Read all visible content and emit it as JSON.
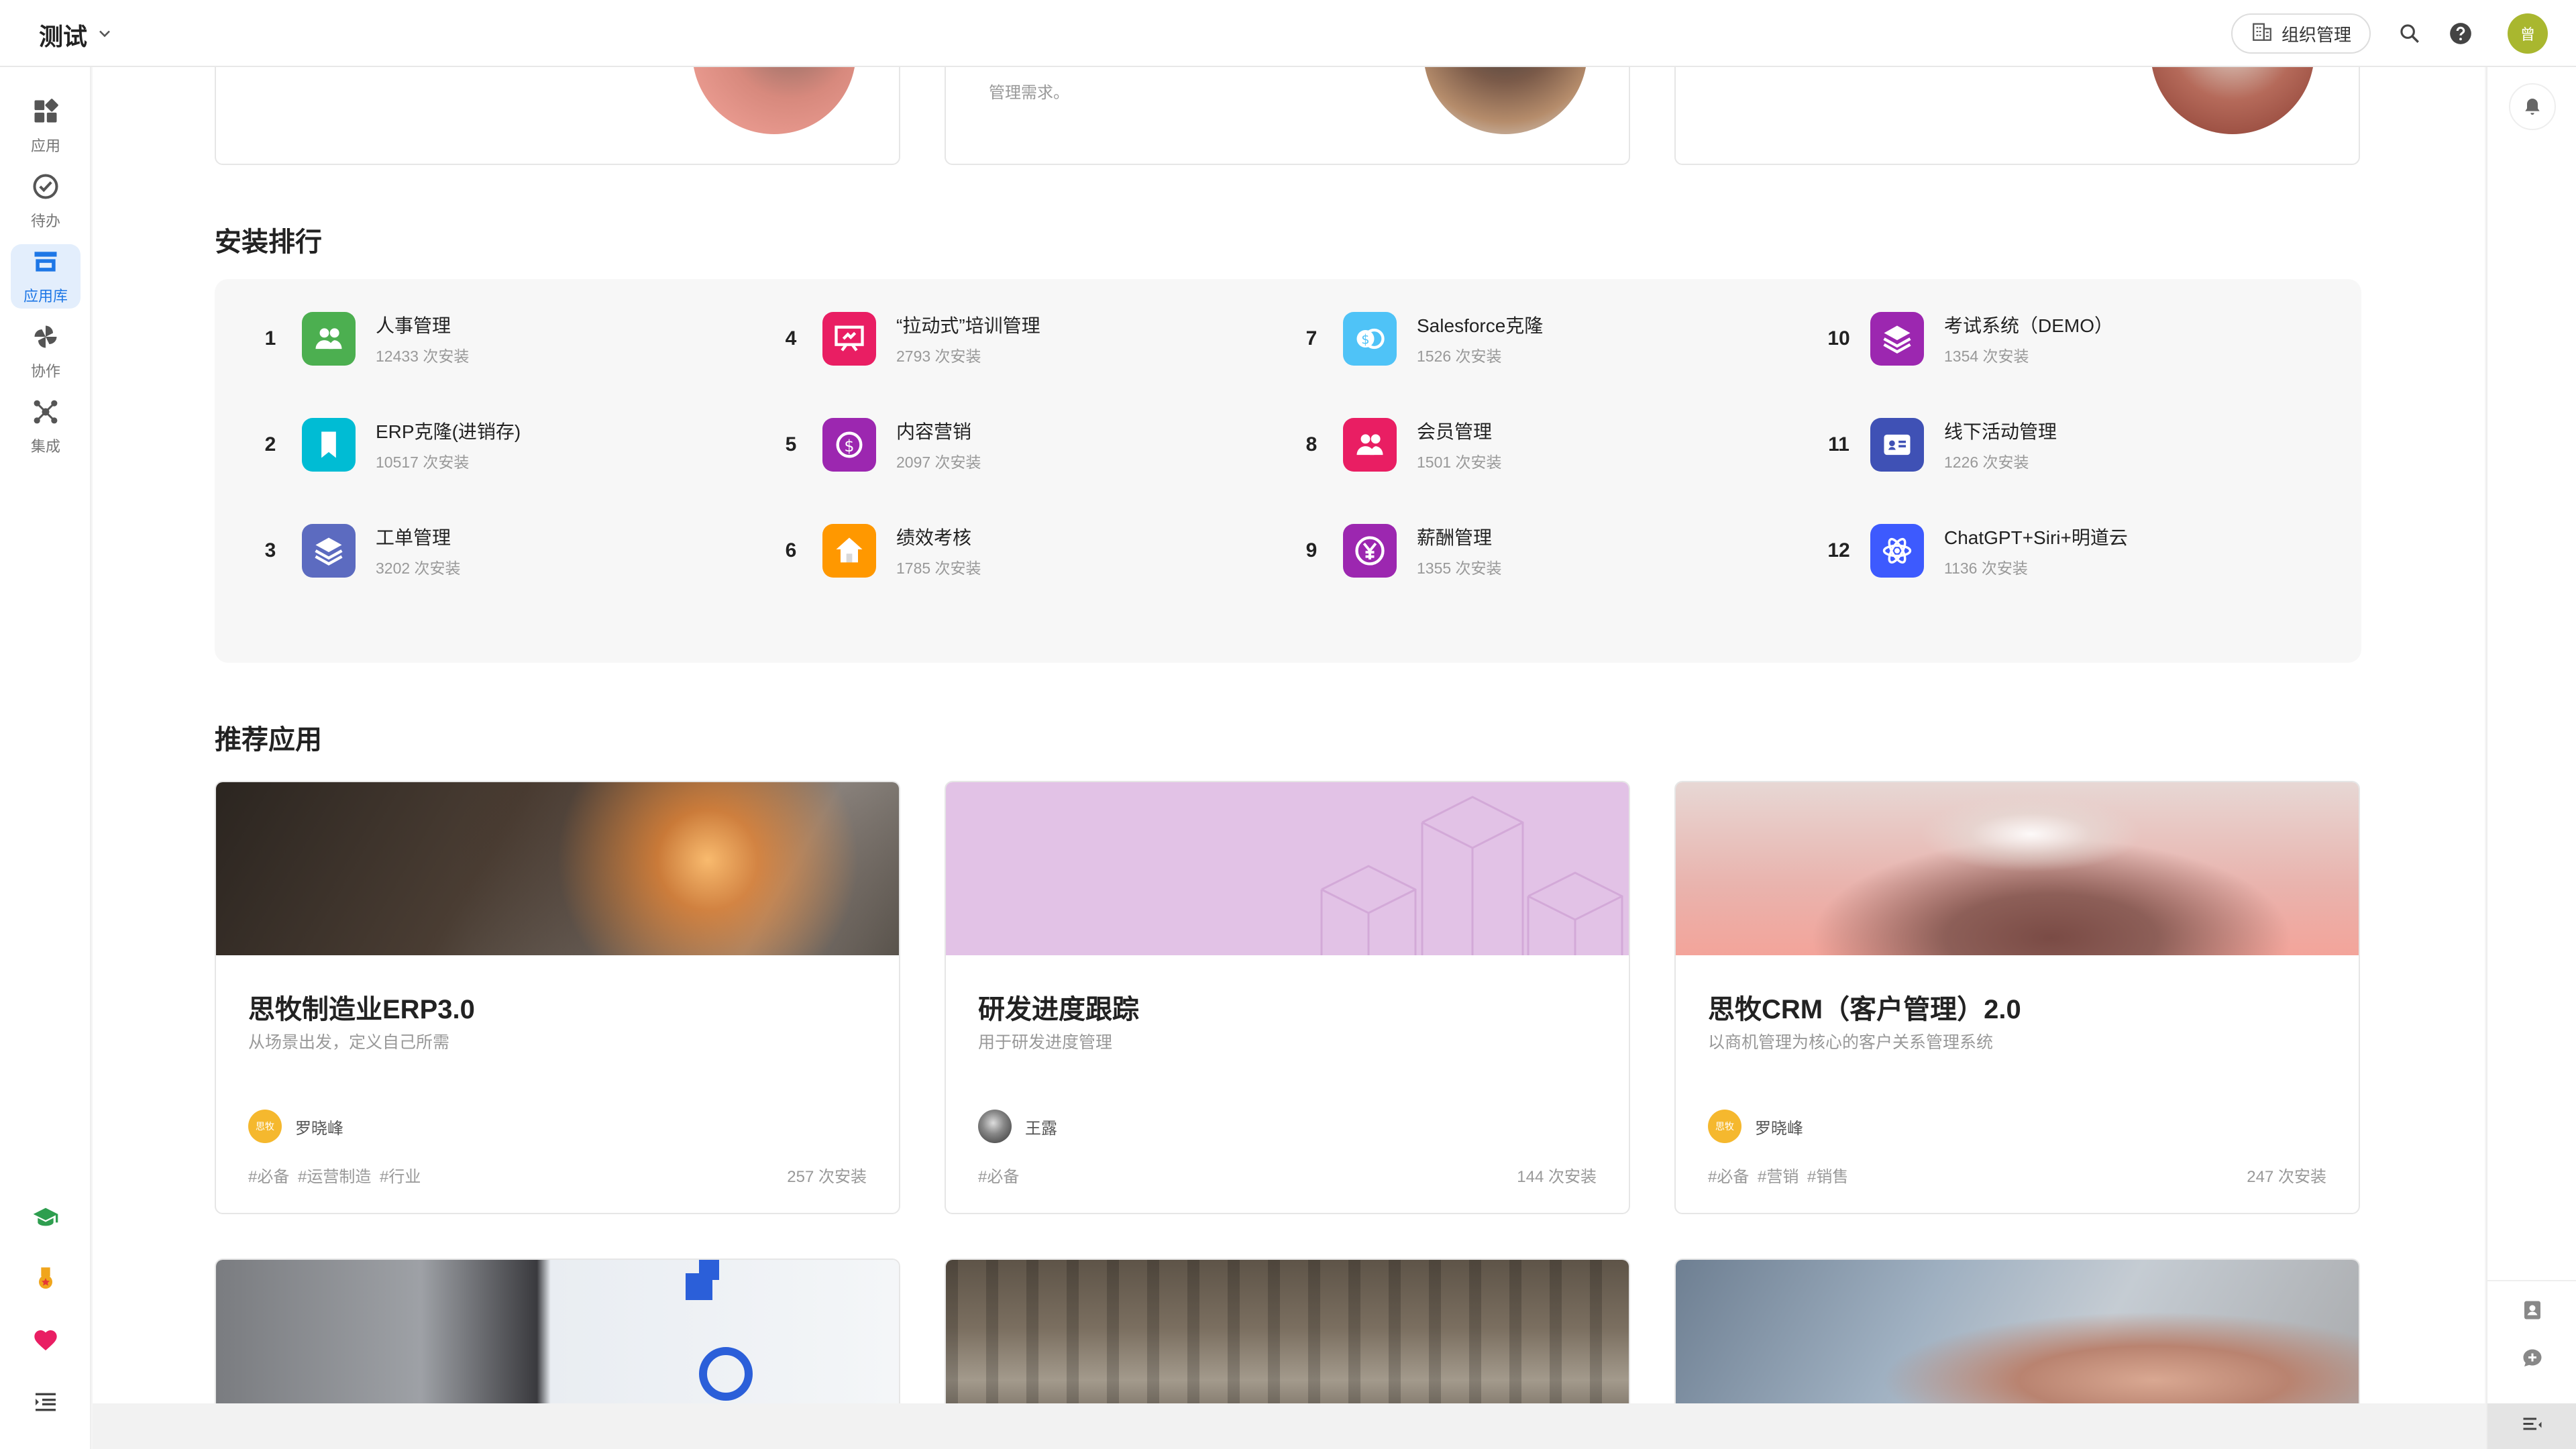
{
  "workspace": {
    "title": "测试"
  },
  "topbar": {
    "org_button": "组织管理",
    "avatar_text": "曾"
  },
  "nav": {
    "items": [
      {
        "label": "应用",
        "icon": "apps-icon"
      },
      {
        "label": "待办",
        "icon": "check-circle-icon"
      },
      {
        "label": "应用库",
        "icon": "store-icon"
      },
      {
        "label": "协作",
        "icon": "pinwheel-icon"
      },
      {
        "label": "集成",
        "icon": "integration-icon"
      }
    ]
  },
  "top_cards": [
    {
      "desc": ""
    },
    {
      "desc": "管理需求。"
    },
    {
      "desc": ""
    }
  ],
  "ranking": {
    "title": "安装排行",
    "items": [
      {
        "rank": "1",
        "name": "人事管理",
        "count": "12433 次安装",
        "color": "#4caf50",
        "icon": "people-icon"
      },
      {
        "rank": "2",
        "name": "ERP克隆(进销存)",
        "count": "10517 次安装",
        "color": "#00bcd4",
        "icon": "bookmark-icon"
      },
      {
        "rank": "3",
        "name": "工单管理",
        "count": "3202 次安装",
        "color": "#5c6bc0",
        "icon": "layers-icon"
      },
      {
        "rank": "4",
        "name": "“拉动式”培训管理",
        "count": "2793 次安装",
        "color": "#e91e63",
        "icon": "presentation-icon"
      },
      {
        "rank": "5",
        "name": "内容营销",
        "count": "2097 次安装",
        "color": "#9c27b0",
        "icon": "money-icon"
      },
      {
        "rank": "6",
        "name": "绩效考核",
        "count": "1785 次安装",
        "color": "#ff9800",
        "icon": "home-icon"
      },
      {
        "rank": "7",
        "name": "Salesforce克隆",
        "count": "1526 次安装",
        "color": "#4fc3f7",
        "icon": "coins-icon"
      },
      {
        "rank": "8",
        "name": "会员管理",
        "count": "1501 次安装",
        "color": "#e91e63",
        "icon": "people-icon"
      },
      {
        "rank": "9",
        "name": "薪酬管理",
        "count": "1355 次安装",
        "color": "#9c27b0",
        "icon": "yen-icon"
      },
      {
        "rank": "10",
        "name": "考试系统（DEMO）",
        "count": "1354 次安装",
        "color": "#9c27b0",
        "icon": "layers-icon"
      },
      {
        "rank": "11",
        "name": "线下活动管理",
        "count": "1226 次安装",
        "color": "#3f51b5",
        "icon": "id-card-icon"
      },
      {
        "rank": "12",
        "name": "ChatGPT+Siri+明道云",
        "count": "1136 次安装",
        "color": "#3d5afe",
        "icon": "atom-icon"
      }
    ]
  },
  "recommended": {
    "title": "推荐应用",
    "cards": [
      {
        "title": "思牧制造业ERP3.0",
        "sub": "从场景出发，定义自己所需",
        "author": "罗晓峰",
        "avatar_text": "思牧",
        "avatar_color": "#f5b82e",
        "tags": "#必备 #运营制造 #行业",
        "installs": "257 次安装"
      },
      {
        "title": "研发进度跟踪",
        "sub": "用于研发进度管理",
        "author": "王露",
        "avatar_text": "",
        "avatar_color": "#555555",
        "tags": "#必备",
        "installs": "144 次安装"
      },
      {
        "title": "思牧CRM（客户管理）2.0",
        "sub": "以商机管理为核心的客户关系管理系统",
        "author": "罗晓峰",
        "avatar_text": "思牧",
        "avatar_color": "#f5b82e",
        "tags": "#必备 #营销 #销售",
        "installs": "247 次安装"
      }
    ]
  }
}
